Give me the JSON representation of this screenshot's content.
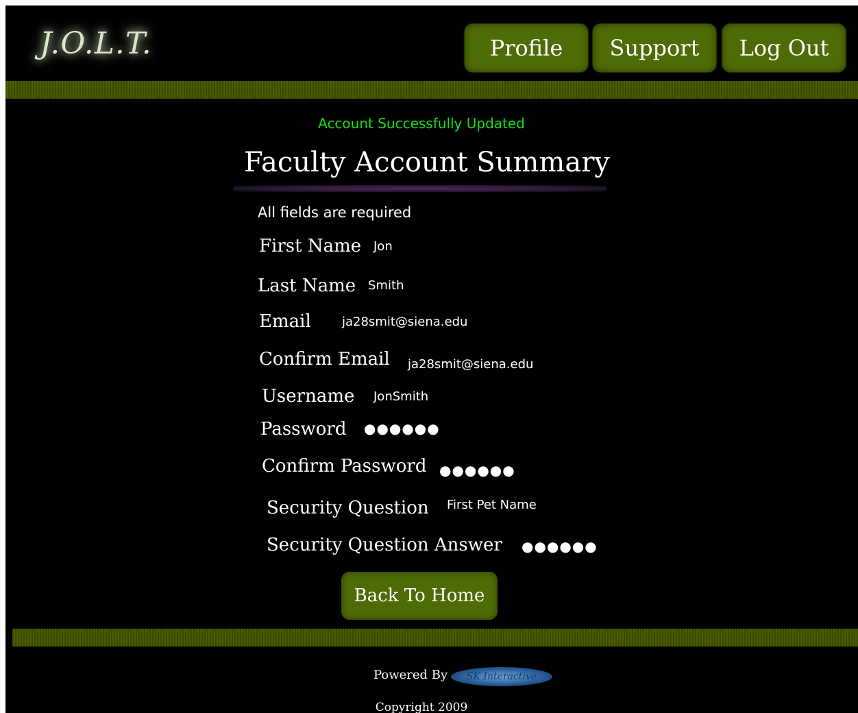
{
  "header": {
    "logo_text": "J.O.L.T.",
    "nav": {
      "profile": "Profile",
      "support": "Support",
      "logout": "Log Out"
    }
  },
  "main": {
    "status_message": "Account Successfully Updated",
    "title": "Faculty Account Summary",
    "required_note": "All fields are required",
    "fields": {
      "first_name": {
        "label": "First Name",
        "value": "Jon"
      },
      "last_name": {
        "label": "Last Name",
        "value": "Smith"
      },
      "email": {
        "label": "Email",
        "value": "ja28smit@siena.edu"
      },
      "confirm_email": {
        "label": "Confirm Email",
        "value": "ja28smit@siena.edu"
      },
      "username": {
        "label": "Username",
        "value": "JonSmith"
      },
      "password": {
        "label": "Password",
        "value": "●●●●●●"
      },
      "confirm_password": {
        "label": "Confirm Password",
        "value": "●●●●●●"
      },
      "security_question": {
        "label": "Security Question",
        "value": "First Pet Name"
      },
      "security_answer": {
        "label": "Security Question Answer",
        "value": "●●●●●●"
      }
    },
    "home_button": "Back To Home"
  },
  "footer": {
    "powered_by": "Powered By",
    "sponsor_logo_text": "SK Interactive",
    "copyright": "Copyright 2009"
  },
  "colors": {
    "background": "#000000",
    "button": "#4f6b06",
    "bar": "#3a4a00",
    "success": "#12e012",
    "text": "#ffffff"
  }
}
